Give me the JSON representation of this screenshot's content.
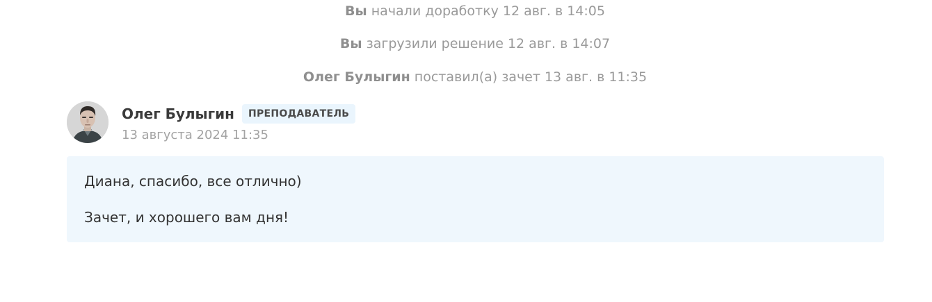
{
  "events": [
    {
      "actor": "Вы",
      "text": "начали доработку 12 авг. в 14:05"
    },
    {
      "actor": "Вы",
      "text": "загрузили решение 12 авг. в 14:07"
    },
    {
      "actor": "Олег Булыгин",
      "text": "поставил(а) зачет 13 авг. в 11:35"
    }
  ],
  "comment": {
    "author": "Олег Булыгин",
    "role": "ПРЕПОДАВАТЕЛЬ",
    "date": "13 августа 2024 11:35",
    "lines": [
      "Диана, спасибо, все отлично)",
      "Зачет, и хорошего вам дня!"
    ]
  },
  "colors": {
    "event_text": "#9a9a9a",
    "badge_bg": "#eaf5fd",
    "comment_bg": "#eff7fd"
  }
}
